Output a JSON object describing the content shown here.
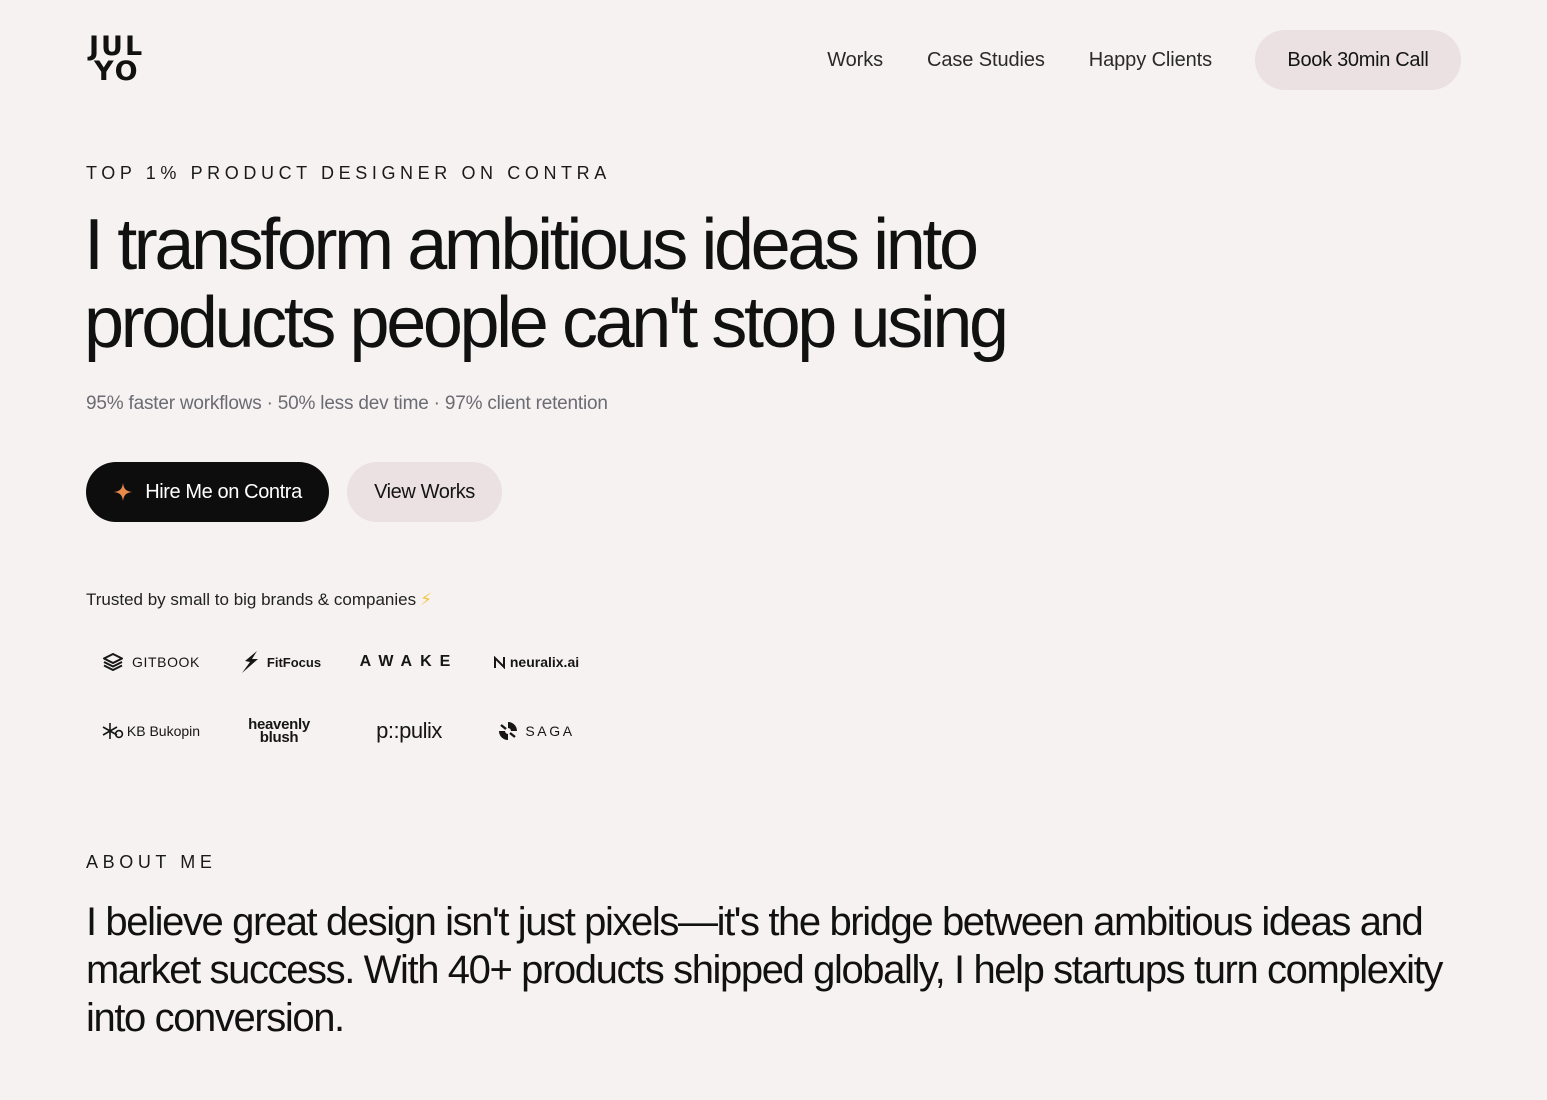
{
  "logo": {
    "line1": "JUL",
    "line2": "YO"
  },
  "nav": {
    "works": "Works",
    "case_studies": "Case Studies",
    "happy_clients": "Happy Clients",
    "book_call": "Book 30min Call"
  },
  "hero": {
    "eyebrow": "TOP 1% PRODUCT DESIGNER ON CONTRA",
    "headline": "I transform ambitious ideas into products people can't stop using",
    "stats": "95% faster workflows · 50% less dev time · 97% client retention",
    "primary_cta": "Hire Me on Contra",
    "secondary_cta": "View Works"
  },
  "trusted": {
    "label": "Trusted by small to big brands & companies",
    "emoji": "⚡",
    "brands": {
      "gitbook": "GITBOOK",
      "fitfocus": "FitFocus",
      "awake": "AWAKE",
      "neuralix": "neuralix.ai",
      "kb_bukopin": "KB Bukopin",
      "heavenly_line1": "heavenly",
      "heavenly_line2": "blush",
      "populix": "p::pulix",
      "saga": "SAGA"
    }
  },
  "about": {
    "eyebrow": "ABOUT ME",
    "text": "I believe great design isn't just pixels—it's the bridge between ambitious ideas and market success. With 40+ products shipped globally, I help startups turn complexity into conversion."
  },
  "colors": {
    "background": "#f6f2f2",
    "pill": "#ebe1e2",
    "dark_button": "#0d0d0d",
    "accent_spark": "#e8894a",
    "muted_text": "#6b6b72"
  },
  "icons": {
    "cta_icon": "sparkle-icon",
    "gitbook_icon": "gitbook-book-icon",
    "fitfocus_icon": "lightning-leaf-icon",
    "neuralix_icon": "n-mark-icon",
    "kb_icon": "asterisk-mark-icon",
    "saga_icon": "swirl-icon"
  }
}
